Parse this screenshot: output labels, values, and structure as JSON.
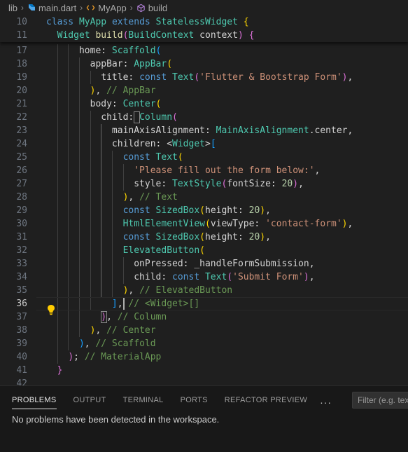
{
  "breadcrumb": {
    "folder": "lib",
    "file": "main.dart",
    "class_name": "MyApp",
    "method": "build"
  },
  "editor": {
    "active_line": 36,
    "sticky_lines": [
      {
        "num": "10",
        "tokens": [
          [
            "k",
            "class "
          ],
          [
            "t",
            "MyApp "
          ],
          [
            "k",
            "extends "
          ],
          [
            "t",
            "StatelessWidget "
          ],
          [
            "b1",
            "{"
          ]
        ]
      },
      {
        "num": "11",
        "tokens": [
          [
            "p",
            "  "
          ],
          [
            "t",
            "Widget "
          ],
          [
            "y",
            "build"
          ],
          [
            "b2",
            "("
          ],
          [
            "t",
            "BuildContext "
          ],
          [
            "p",
            "context"
          ],
          [
            "b2",
            ")"
          ],
          [
            "p",
            " "
          ],
          [
            "b2",
            "{"
          ]
        ]
      }
    ],
    "lines": [
      {
        "num": "17",
        "tokens": [
          [
            "p",
            "      home: "
          ],
          [
            "t",
            "Scaffold"
          ],
          [
            "b3",
            "("
          ]
        ]
      },
      {
        "num": "18",
        "tokens": [
          [
            "p",
            "        appBar: "
          ],
          [
            "t",
            "AppBar"
          ],
          [
            "b1",
            "("
          ]
        ]
      },
      {
        "num": "19",
        "tokens": [
          [
            "p",
            "          title: "
          ],
          [
            "k",
            "const "
          ],
          [
            "t",
            "Text"
          ],
          [
            "b2",
            "("
          ],
          [
            "s",
            "'Flutter & Bootstrap Form'"
          ],
          [
            "b2",
            ")"
          ],
          [
            "p",
            ","
          ]
        ]
      },
      {
        "num": "20",
        "tokens": [
          [
            "p",
            "        "
          ],
          [
            "b1",
            ")"
          ],
          [
            "p",
            ", "
          ],
          [
            "c",
            "// AppBar"
          ]
        ]
      },
      {
        "num": "21",
        "tokens": [
          [
            "p",
            "        body: "
          ],
          [
            "t",
            "Center"
          ],
          [
            "b1",
            "("
          ]
        ]
      },
      {
        "num": "22",
        "tokens": [
          [
            "p",
            "          child: "
          ],
          [
            "t",
            "Column"
          ],
          [
            "b2",
            "("
          ]
        ]
      },
      {
        "num": "23",
        "tokens": [
          [
            "p",
            "            mainAxisAlignment: "
          ],
          [
            "t",
            "MainAxisAlignment"
          ],
          [
            "p",
            "."
          ],
          [
            "p",
            "center,"
          ]
        ]
      },
      {
        "num": "24",
        "tokens": [
          [
            "p",
            "            children: "
          ],
          [
            "p",
            "<"
          ],
          [
            "t",
            "Widget"
          ],
          [
            "p",
            ">"
          ],
          [
            "b3",
            "["
          ]
        ]
      },
      {
        "num": "25",
        "tokens": [
          [
            "p",
            "              "
          ],
          [
            "k",
            "const "
          ],
          [
            "t",
            "Text"
          ],
          [
            "b1",
            "("
          ]
        ]
      },
      {
        "num": "26",
        "tokens": [
          [
            "p",
            "                "
          ],
          [
            "s",
            "'Please fill out the form below:'"
          ],
          [
            "p",
            ","
          ]
        ]
      },
      {
        "num": "27",
        "tokens": [
          [
            "p",
            "                style: "
          ],
          [
            "t",
            "TextStyle"
          ],
          [
            "b2",
            "("
          ],
          [
            "p",
            "fontSize: "
          ],
          [
            "n",
            "20"
          ],
          [
            "b2",
            ")"
          ],
          [
            "p",
            ","
          ]
        ]
      },
      {
        "num": "28",
        "tokens": [
          [
            "p",
            "              "
          ],
          [
            "b1",
            ")"
          ],
          [
            "p",
            ", "
          ],
          [
            "c",
            "// Text"
          ]
        ]
      },
      {
        "num": "29",
        "tokens": [
          [
            "p",
            "              "
          ],
          [
            "k",
            "const "
          ],
          [
            "t",
            "SizedBox"
          ],
          [
            "b1",
            "("
          ],
          [
            "p",
            "height: "
          ],
          [
            "n",
            "20"
          ],
          [
            "b1",
            ")"
          ],
          [
            "p",
            ","
          ]
        ]
      },
      {
        "num": "30",
        "tokens": [
          [
            "p",
            "              "
          ],
          [
            "t",
            "HtmlElementView"
          ],
          [
            "b1",
            "("
          ],
          [
            "p",
            "viewType: "
          ],
          [
            "s",
            "'contact-form'"
          ],
          [
            "b1",
            ")"
          ],
          [
            "p",
            ","
          ]
        ]
      },
      {
        "num": "31",
        "tokens": [
          [
            "p",
            "              "
          ],
          [
            "k",
            "const "
          ],
          [
            "t",
            "SizedBox"
          ],
          [
            "b1",
            "("
          ],
          [
            "p",
            "height: "
          ],
          [
            "n",
            "20"
          ],
          [
            "b1",
            ")"
          ],
          [
            "p",
            ","
          ]
        ]
      },
      {
        "num": "32",
        "tokens": [
          [
            "p",
            "              "
          ],
          [
            "t",
            "ElevatedButton"
          ],
          [
            "b1",
            "("
          ]
        ]
      },
      {
        "num": "33",
        "tokens": [
          [
            "p",
            "                onPressed: "
          ],
          [
            "p",
            "_handleFormSubmission,"
          ]
        ]
      },
      {
        "num": "34",
        "tokens": [
          [
            "p",
            "                child: "
          ],
          [
            "k",
            "const "
          ],
          [
            "t",
            "Text"
          ],
          [
            "b2",
            "("
          ],
          [
            "s",
            "'Submit Form'"
          ],
          [
            "b2",
            ")"
          ],
          [
            "p",
            ","
          ]
        ]
      },
      {
        "num": "35",
        "tokens": [
          [
            "p",
            "              "
          ],
          [
            "b1",
            ")"
          ],
          [
            "p",
            ", "
          ],
          [
            "c",
            "// ElevatedButton"
          ]
        ]
      },
      {
        "num": "36",
        "tokens": [
          [
            "p",
            "            "
          ],
          [
            "b3",
            "]"
          ],
          [
            "p",
            ", "
          ],
          [
            "c",
            "// <Widget>[]"
          ]
        ]
      },
      {
        "num": "37",
        "tokens": [
          [
            "p",
            "          "
          ],
          [
            "b2",
            ")"
          ],
          [
            "p",
            ", "
          ],
          [
            "c",
            "// Column"
          ]
        ]
      },
      {
        "num": "38",
        "tokens": [
          [
            "p",
            "        "
          ],
          [
            "b1",
            ")"
          ],
          [
            "p",
            ", "
          ],
          [
            "c",
            "// Center"
          ]
        ]
      },
      {
        "num": "39",
        "tokens": [
          [
            "p",
            "      "
          ],
          [
            "b3",
            ")"
          ],
          [
            "p",
            ", "
          ],
          [
            "c",
            "// Scaffold"
          ]
        ]
      },
      {
        "num": "40",
        "tokens": [
          [
            "p",
            "    "
          ],
          [
            "b2",
            ")"
          ],
          [
            "p",
            "; "
          ],
          [
            "c",
            "// MaterialApp"
          ]
        ]
      },
      {
        "num": "41",
        "tokens": [
          [
            "p",
            "  "
          ],
          [
            "b2",
            "}"
          ]
        ]
      },
      {
        "num": "42",
        "tokens": []
      }
    ]
  },
  "panel": {
    "tabs": [
      {
        "label": "PROBLEMS",
        "active": true
      },
      {
        "label": "OUTPUT",
        "active": false
      },
      {
        "label": "TERMINAL",
        "active": false
      },
      {
        "label": "PORTS",
        "active": false
      },
      {
        "label": "REFACTOR PREVIEW",
        "active": false
      }
    ],
    "more_label": "···",
    "filter_placeholder": "Filter (e.g. text",
    "message": "No problems have been detected in the workspace."
  },
  "colors": {
    "background": "#1f1f1f",
    "keyword": "#569cd6",
    "type": "#4ec9b0",
    "function": "#dcdcaa",
    "string": "#ce9178",
    "number": "#b5cea8",
    "comment": "#6a9955",
    "bracket_gold": "#ffd700",
    "bracket_orchid": "#da70d6",
    "bracket_blue": "#179fff",
    "lightbulb": "#ffcc00"
  },
  "icons": {
    "file_icon": "dart-file-icon",
    "class_icon": "class-icon",
    "method_icon": "method-cube-icon",
    "lightbulb": "lightbulb-icon"
  }
}
